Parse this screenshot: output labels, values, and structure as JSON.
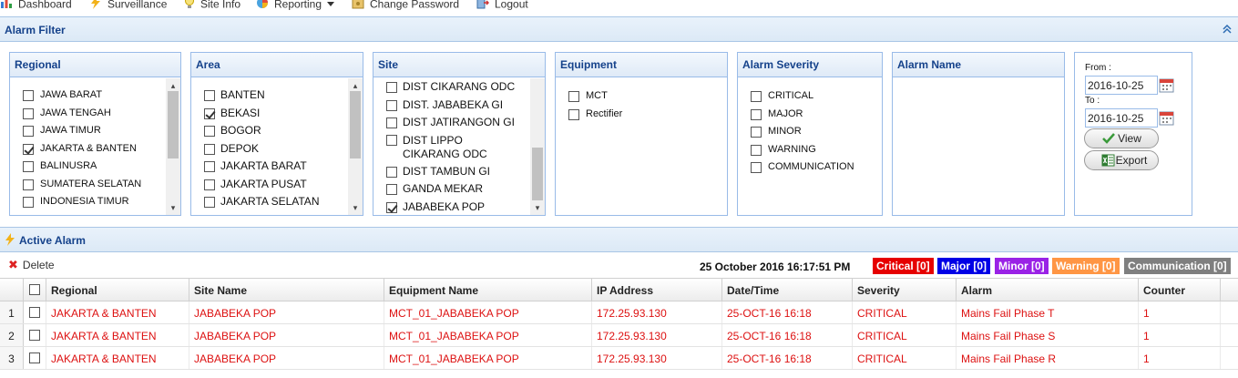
{
  "nav": {
    "dashboard": "Dashboard",
    "surveillance": "Surveillance",
    "site_info": "Site Info",
    "reporting": "Reporting",
    "change_password": "Change Password",
    "logout": "Logout"
  },
  "alarm_filter": {
    "title": "Alarm Filter",
    "regional": {
      "header": "Regional",
      "items": [
        {
          "label": "JAWA BARAT",
          "checked": false
        },
        {
          "label": "JAWA TENGAH",
          "checked": false
        },
        {
          "label": "JAWA TIMUR",
          "checked": false
        },
        {
          "label": "JAKARTA & BANTEN",
          "checked": true
        },
        {
          "label": "BALINUSRA",
          "checked": false
        },
        {
          "label": "SUMATERA SELATAN",
          "checked": false
        },
        {
          "label": "INDONESIA TIMUR",
          "checked": false
        }
      ]
    },
    "area": {
      "header": "Area",
      "items": [
        {
          "label": "BANTEN",
          "checked": false
        },
        {
          "label": "BEKASI",
          "checked": true
        },
        {
          "label": "BOGOR",
          "checked": false
        },
        {
          "label": "DEPOK",
          "checked": false
        },
        {
          "label": "JAKARTA BARAT",
          "checked": false
        },
        {
          "label": "JAKARTA PUSAT",
          "checked": false
        },
        {
          "label": "JAKARTA SELATAN",
          "checked": false
        }
      ]
    },
    "site": {
      "header": "Site",
      "items": [
        {
          "label": "DIST CIKARANG ODC",
          "checked": false
        },
        {
          "label": "DIST. JABABEKA GI",
          "checked": false
        },
        {
          "label": "DIST JATIRANGON GI",
          "checked": false
        },
        {
          "label": "DIST LIPPO CIKARANG ODC",
          "checked": false
        },
        {
          "label": "DIST TAMBUN GI",
          "checked": false
        },
        {
          "label": "GANDA MEKAR",
          "checked": false
        },
        {
          "label": "JABABEKA POP",
          "checked": true
        }
      ]
    },
    "equipment": {
      "header": "Equipment",
      "items": [
        {
          "label": "MCT",
          "checked": false
        },
        {
          "label": "Rectifier",
          "checked": false
        }
      ]
    },
    "severity": {
      "header": "Alarm Severity",
      "items": [
        {
          "label": "CRITICAL",
          "checked": false
        },
        {
          "label": "MAJOR",
          "checked": false
        },
        {
          "label": "MINOR",
          "checked": false
        },
        {
          "label": "WARNING",
          "checked": false
        },
        {
          "label": "COMMUNICATION",
          "checked": false
        }
      ]
    },
    "alarm_name": {
      "header": "Alarm Name"
    },
    "date": {
      "from_label": "From :",
      "from_value": "2016-10-25",
      "to_label": "To :",
      "to_value": "2016-10-25",
      "view_label": "View",
      "export_label": "Export"
    }
  },
  "active_alarm": {
    "title": "Active Alarm",
    "delete_label": "Delete",
    "datetime": "25 October 2016 16:17:51 PM",
    "severity_badges": [
      {
        "label": "Critical [0]",
        "color": "#e60000"
      },
      {
        "label": "Major [0]",
        "color": "#0000e6"
      },
      {
        "label": "Minor [0]",
        "color": "#9a22e6"
      },
      {
        "label": "Warning [0]",
        "color": "#ff9644"
      },
      {
        "label": "Communication [0]",
        "color": "#7f7f7f"
      }
    ],
    "columns": [
      "Regional",
      "Site Name",
      "Equipment Name",
      "IP Address",
      "Date/Time",
      "Severity",
      "Alarm",
      "Counter"
    ],
    "rows": [
      {
        "num": "1",
        "cells": [
          "JAKARTA & BANTEN",
          "JABABEKA POP",
          "MCT_01_JABABEKA POP",
          "172.25.93.130",
          "25-OCT-16 16:18",
          "CRITICAL",
          "Mains Fail Phase T",
          "1"
        ]
      },
      {
        "num": "2",
        "cells": [
          "JAKARTA & BANTEN",
          "JABABEKA POP",
          "MCT_01_JABABEKA POP",
          "172.25.93.130",
          "25-OCT-16 16:18",
          "CRITICAL",
          "Mains Fail Phase S",
          "1"
        ]
      },
      {
        "num": "3",
        "cells": [
          "JAKARTA & BANTEN",
          "JABABEKA POP",
          "MCT_01_JABABEKA POP",
          "172.25.93.130",
          "25-OCT-16 16:18",
          "CRITICAL",
          "Mains Fail Phase R",
          "1"
        ]
      }
    ]
  }
}
